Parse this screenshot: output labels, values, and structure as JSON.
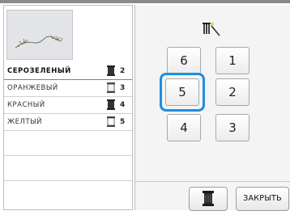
{
  "thread_list": {
    "items": [
      {
        "name": "СЕРОЗЕЛЕНЫЙ",
        "number": "2",
        "selected": true
      },
      {
        "name": "ОРАНЖЕВЫЙ",
        "number": "3",
        "selected": false
      },
      {
        "name": "КРАСНЫЙ",
        "number": "4",
        "selected": false
      },
      {
        "name": "ЖЕЛТЫЙ",
        "number": "5",
        "selected": false
      }
    ]
  },
  "needle_keys": {
    "n6": "6",
    "n1": "1",
    "n5": "5",
    "n2": "2",
    "n4": "4",
    "n3": "3",
    "selected": "5"
  },
  "footer": {
    "close_label": "ЗАКРЫТЬ"
  },
  "colors": {
    "accent": "#1e8ee0",
    "spool_dark": "#333333"
  },
  "icons": {
    "mode": "needle-bar-wand-icon",
    "spool": "thread-spool-icon"
  }
}
